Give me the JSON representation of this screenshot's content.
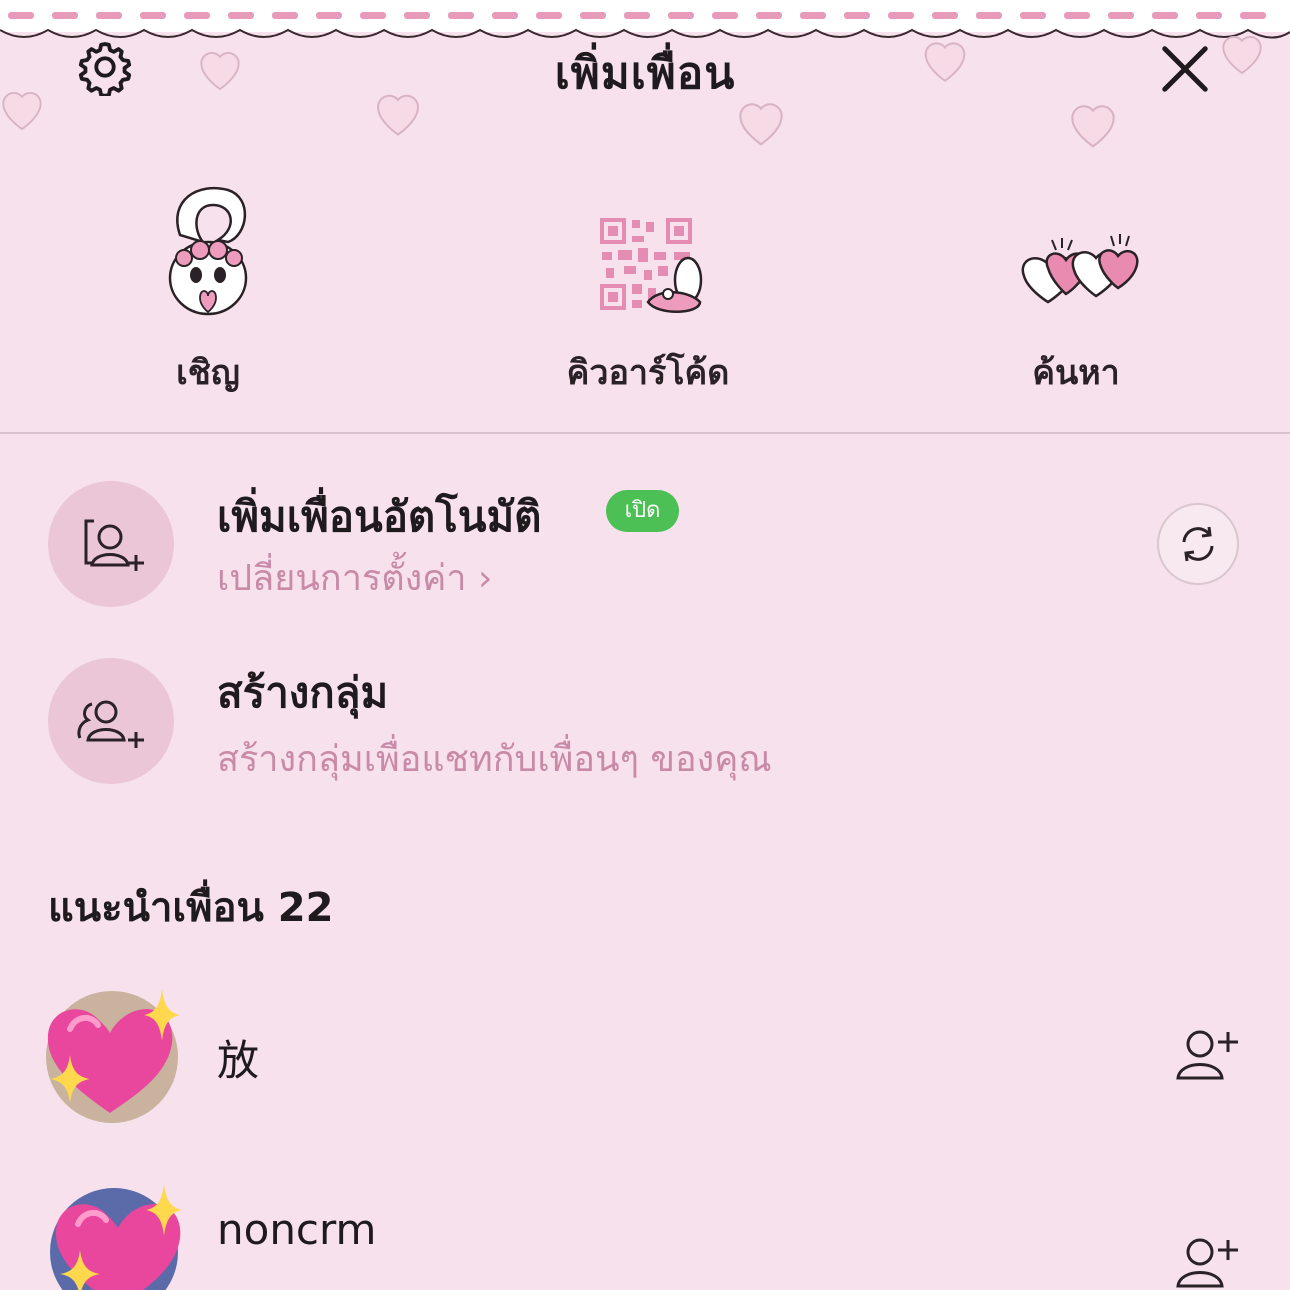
{
  "header": {
    "title": "เพิ่มเพื่อน",
    "settings_icon": "gear-icon",
    "close_icon": "close-icon"
  },
  "quick_actions": [
    {
      "label": "เชิญ",
      "icon": "bunny-mascot-icon"
    },
    {
      "label": "คิวอาร์โค้ด",
      "icon": "qr-code-icon"
    },
    {
      "label": "ค้นหา",
      "icon": "heart-balloons-icon"
    }
  ],
  "auto_add": {
    "title": "เพิ่มเพื่อนอัตโนมัติ",
    "badge": "เปิด",
    "subtitle": "เปลี่ยนการตั้งค่า ›",
    "icon": "auto-add-friend-icon",
    "refresh_icon": "refresh-icon"
  },
  "create_group": {
    "title": "สร้างกลุ่ม",
    "subtitle": "สร้างกลุ่มเพื่อแชทกับเพื่อนๆ ของคุณ",
    "icon": "group-add-icon"
  },
  "suggestions": {
    "header": "แนะนำเพื่อน 22",
    "items": [
      {
        "name": "放",
        "avatar_icon": "sparkling-heart-icon",
        "action_icon": "add-friend-icon"
      },
      {
        "name": "noncrm",
        "avatar_icon": "sparkling-heart-icon",
        "action_icon": "add-friend-icon"
      }
    ]
  },
  "colors": {
    "background": "#f6e1ec",
    "accent_pink": "#c98aa8",
    "badge_green": "#4cbf55"
  }
}
